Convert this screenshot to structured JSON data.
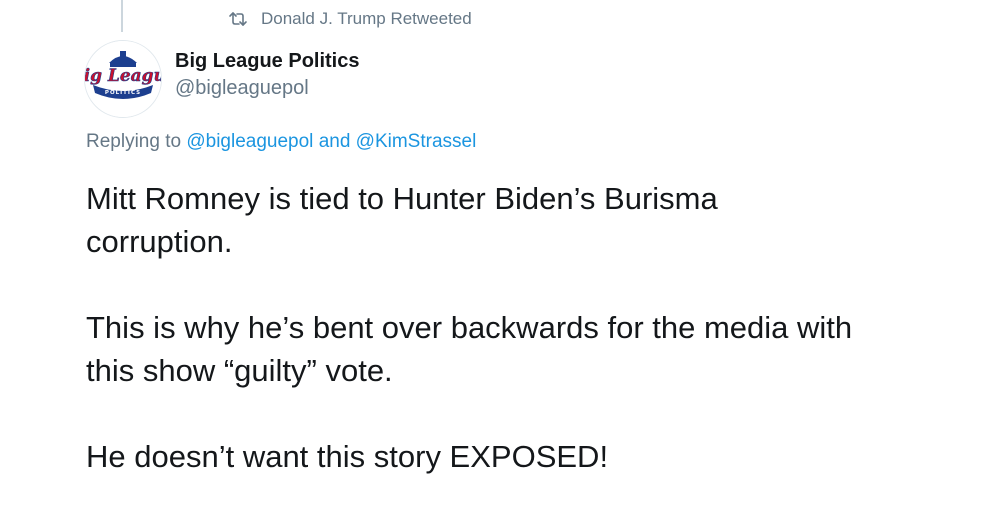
{
  "retweet_context": {
    "text": "Donald J. Trump Retweeted"
  },
  "author": {
    "display_name": "Big League Politics",
    "handle": "@bigleaguepol",
    "avatar": {
      "wordmark": "Big League",
      "banner": "POLITICS"
    }
  },
  "reply": {
    "prefix": "Replying to",
    "mentions": [
      "@bigleaguepol",
      "@KimStrassel"
    ],
    "conjunction": "and"
  },
  "tweet": {
    "paragraphs": [
      [
        "Mitt Romney is tied to Hunter Biden’s Burisma",
        "corruption."
      ],
      [
        "This is why he’s bent over backwards for the media with",
        "this show “guilty” vote."
      ],
      [
        "He doesn’t want this story EXPOSED!"
      ]
    ]
  },
  "colors": {
    "secondary_text": "#657786",
    "link": "#1b95e0",
    "primary_text": "#14171a",
    "logo_red": "#c8102e",
    "logo_blue": "#1d3f8f"
  },
  "icons": {
    "retweet": "retweet-icon"
  }
}
